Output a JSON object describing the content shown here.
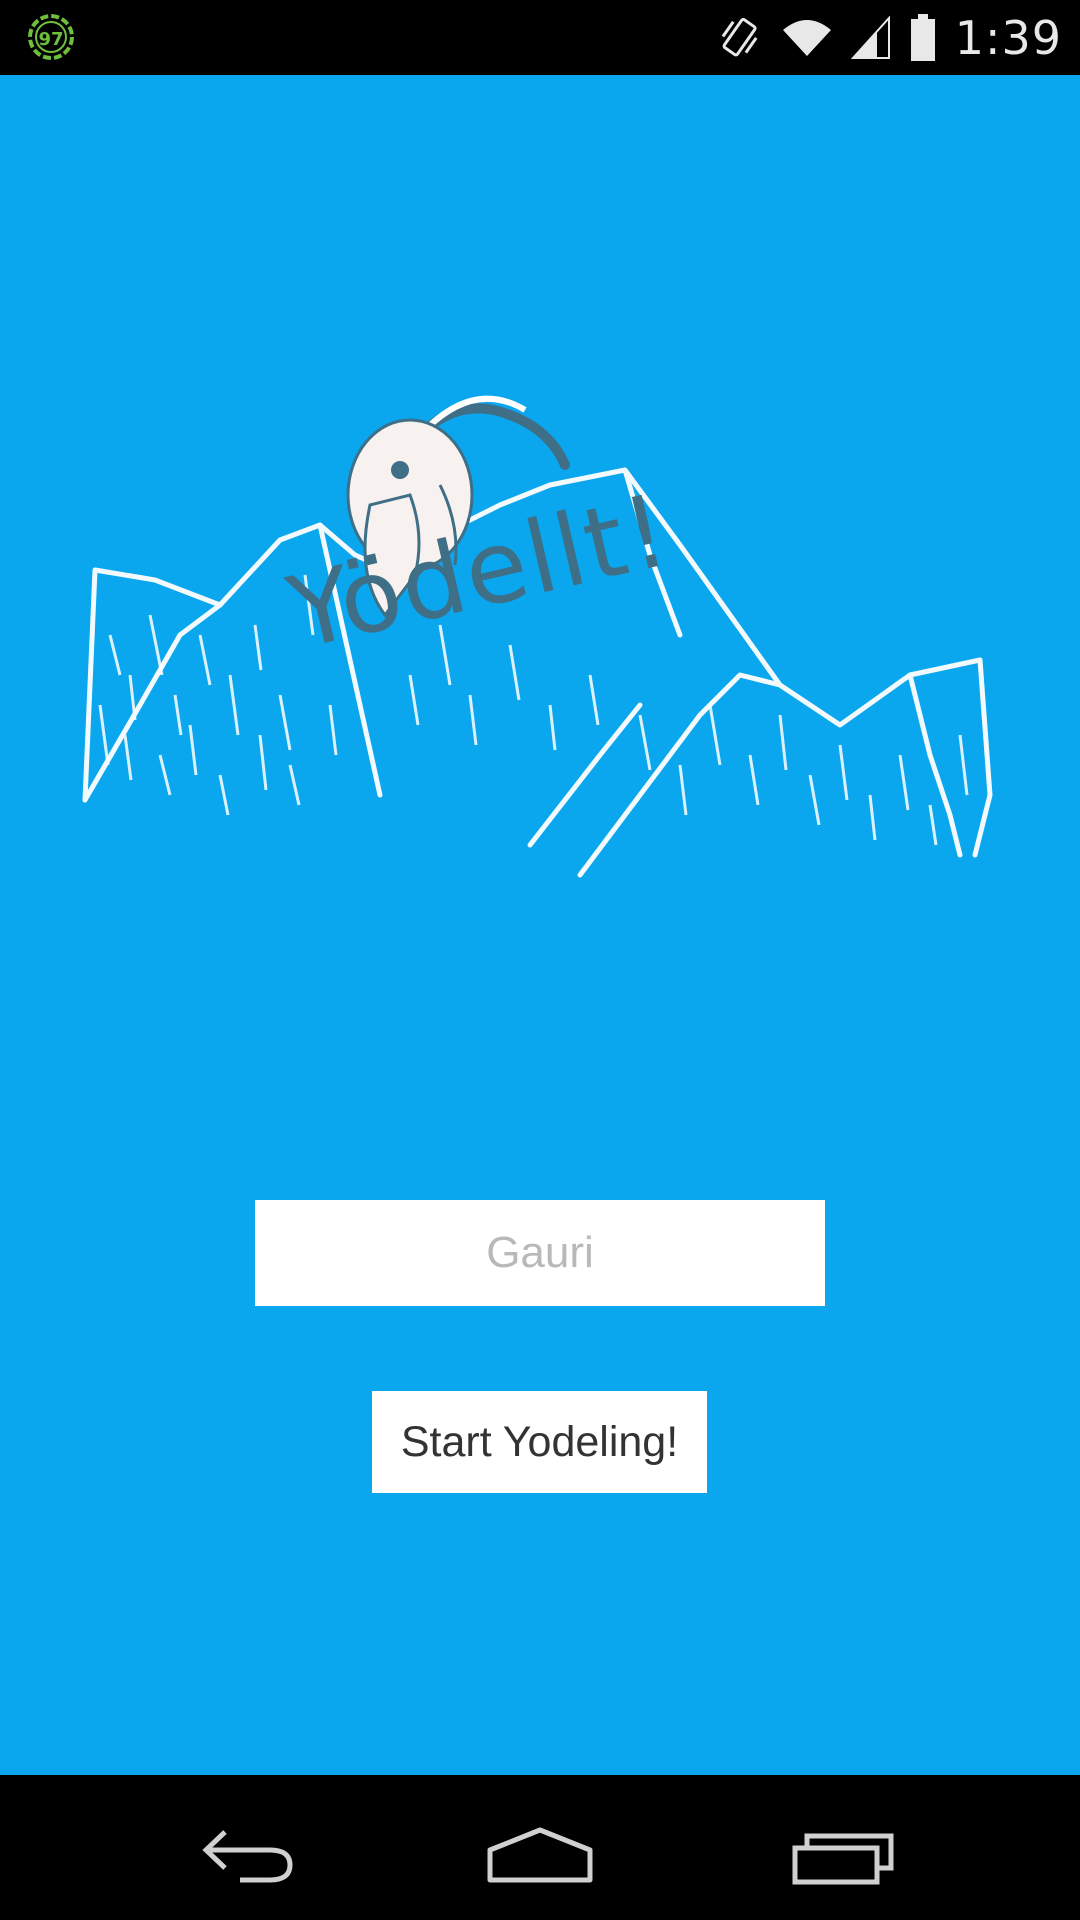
{
  "status_bar": {
    "notification_badge": "97",
    "clock": "1:39",
    "icons": [
      "vibrate-icon",
      "wifi-icon",
      "cell-signal-icon",
      "battery-icon"
    ]
  },
  "app": {
    "background_color": "#0aa6ee",
    "logo_text": "Yödellt!",
    "name_input": {
      "value": "Gauri"
    },
    "start_button_label": "Start Yodeling!"
  },
  "nav_bar": {
    "buttons": [
      "back-icon",
      "home-icon",
      "recents-icon"
    ]
  }
}
